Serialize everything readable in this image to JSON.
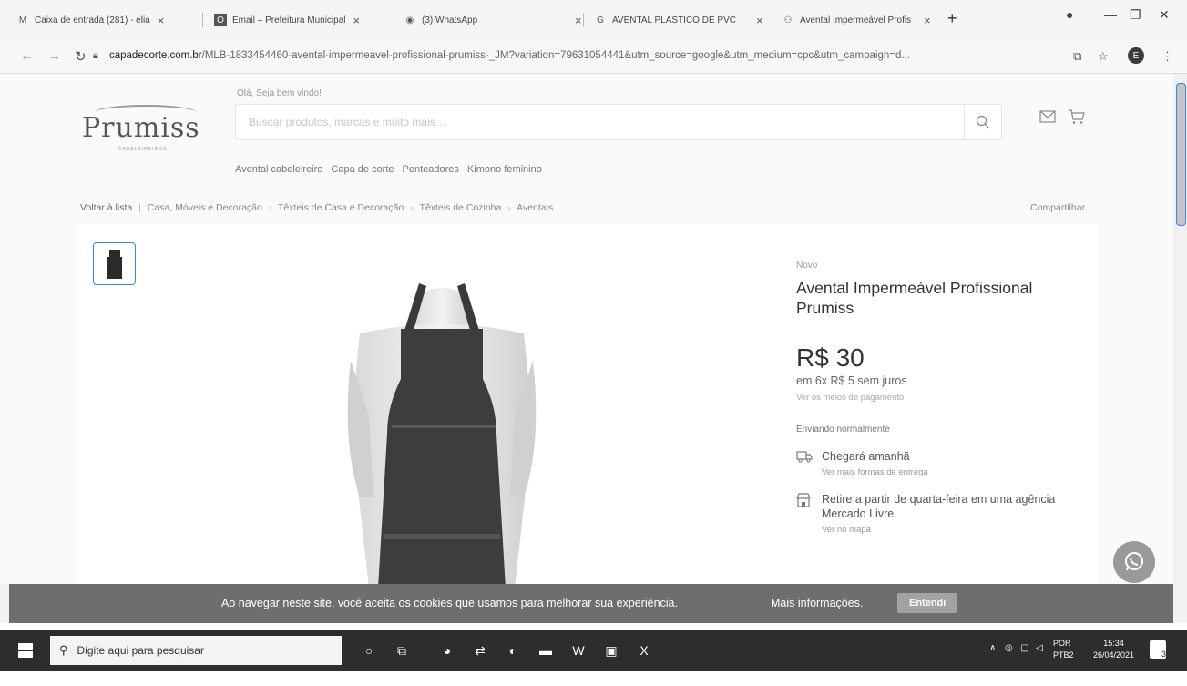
{
  "browser": {
    "tabs": [
      {
        "icon": "gmail-icon",
        "glyph": "M",
        "title": "Caixa de entrada (281) - elia"
      },
      {
        "icon": "outlook-icon",
        "glyph": "O",
        "title": "Email – Prefeitura Municipal"
      },
      {
        "icon": "whatsapp-icon",
        "glyph": "◉",
        "title": "(3) WhatsApp"
      },
      {
        "icon": "google-icon",
        "glyph": "G",
        "title": "AVENTAL PLÁSTICO DE PVC"
      },
      {
        "icon": "handshake-icon",
        "glyph": "⚇",
        "title": "Avental Impermeável Profis"
      }
    ],
    "new_tab": "+",
    "url_host": "capadecorte.com.br",
    "url_path": "/MLB-1833454460-avental-impermeavel-profissional-prumiss-_JM?variation=79631054441&utm_source=google&utm_medium=cpc&utm_campaign=d...",
    "profile_initial": "E"
  },
  "header": {
    "logo": "Prumiss",
    "logo_tag": "CABELEIREIROS",
    "welcome": "Olá, Seja bem vindo!",
    "search_placeholder": "Buscar produtos, marcas e muito mais…",
    "categories": [
      "Avental cabeleireiro",
      "Capa de corte",
      "Penteadores",
      "Kimono feminino"
    ]
  },
  "breadcrumb": {
    "back": "Voltar à lista",
    "items": [
      "Casa, Móveis e Decoração",
      "Têxteis de Casa e Decoração",
      "Têxteis de Cozinha",
      "Aventais"
    ],
    "share": "Compartilhar"
  },
  "product": {
    "condition": "Novo",
    "title": "Avental Impermeável Profissional Prumiss",
    "price": "R$ 30",
    "installments": "em 6x R$ 5 sem juros",
    "payment_link": "Ver os meios de pagamento",
    "shipping_status": "Enviando normalmente",
    "delivery_main": "Chegará amanhã",
    "delivery_sub": "Ver mais formas de entrega",
    "pickup_main": "Retire a partir de quarta-feira em uma agência Mercado Livre",
    "pickup_sub": "Ver no mapa"
  },
  "cookie": {
    "text": "Ao navegar neste site, você aceita os cookies que usamos para melhorar sua experiência.",
    "more": "Mais informações.",
    "button": "Entendi"
  },
  "taskbar": {
    "search_placeholder": "Digite aqui para pesquisar",
    "lang_1": "POR",
    "lang_2": "PTB2",
    "time": "15:34",
    "date": "26/04/2021",
    "notifications": "3"
  }
}
